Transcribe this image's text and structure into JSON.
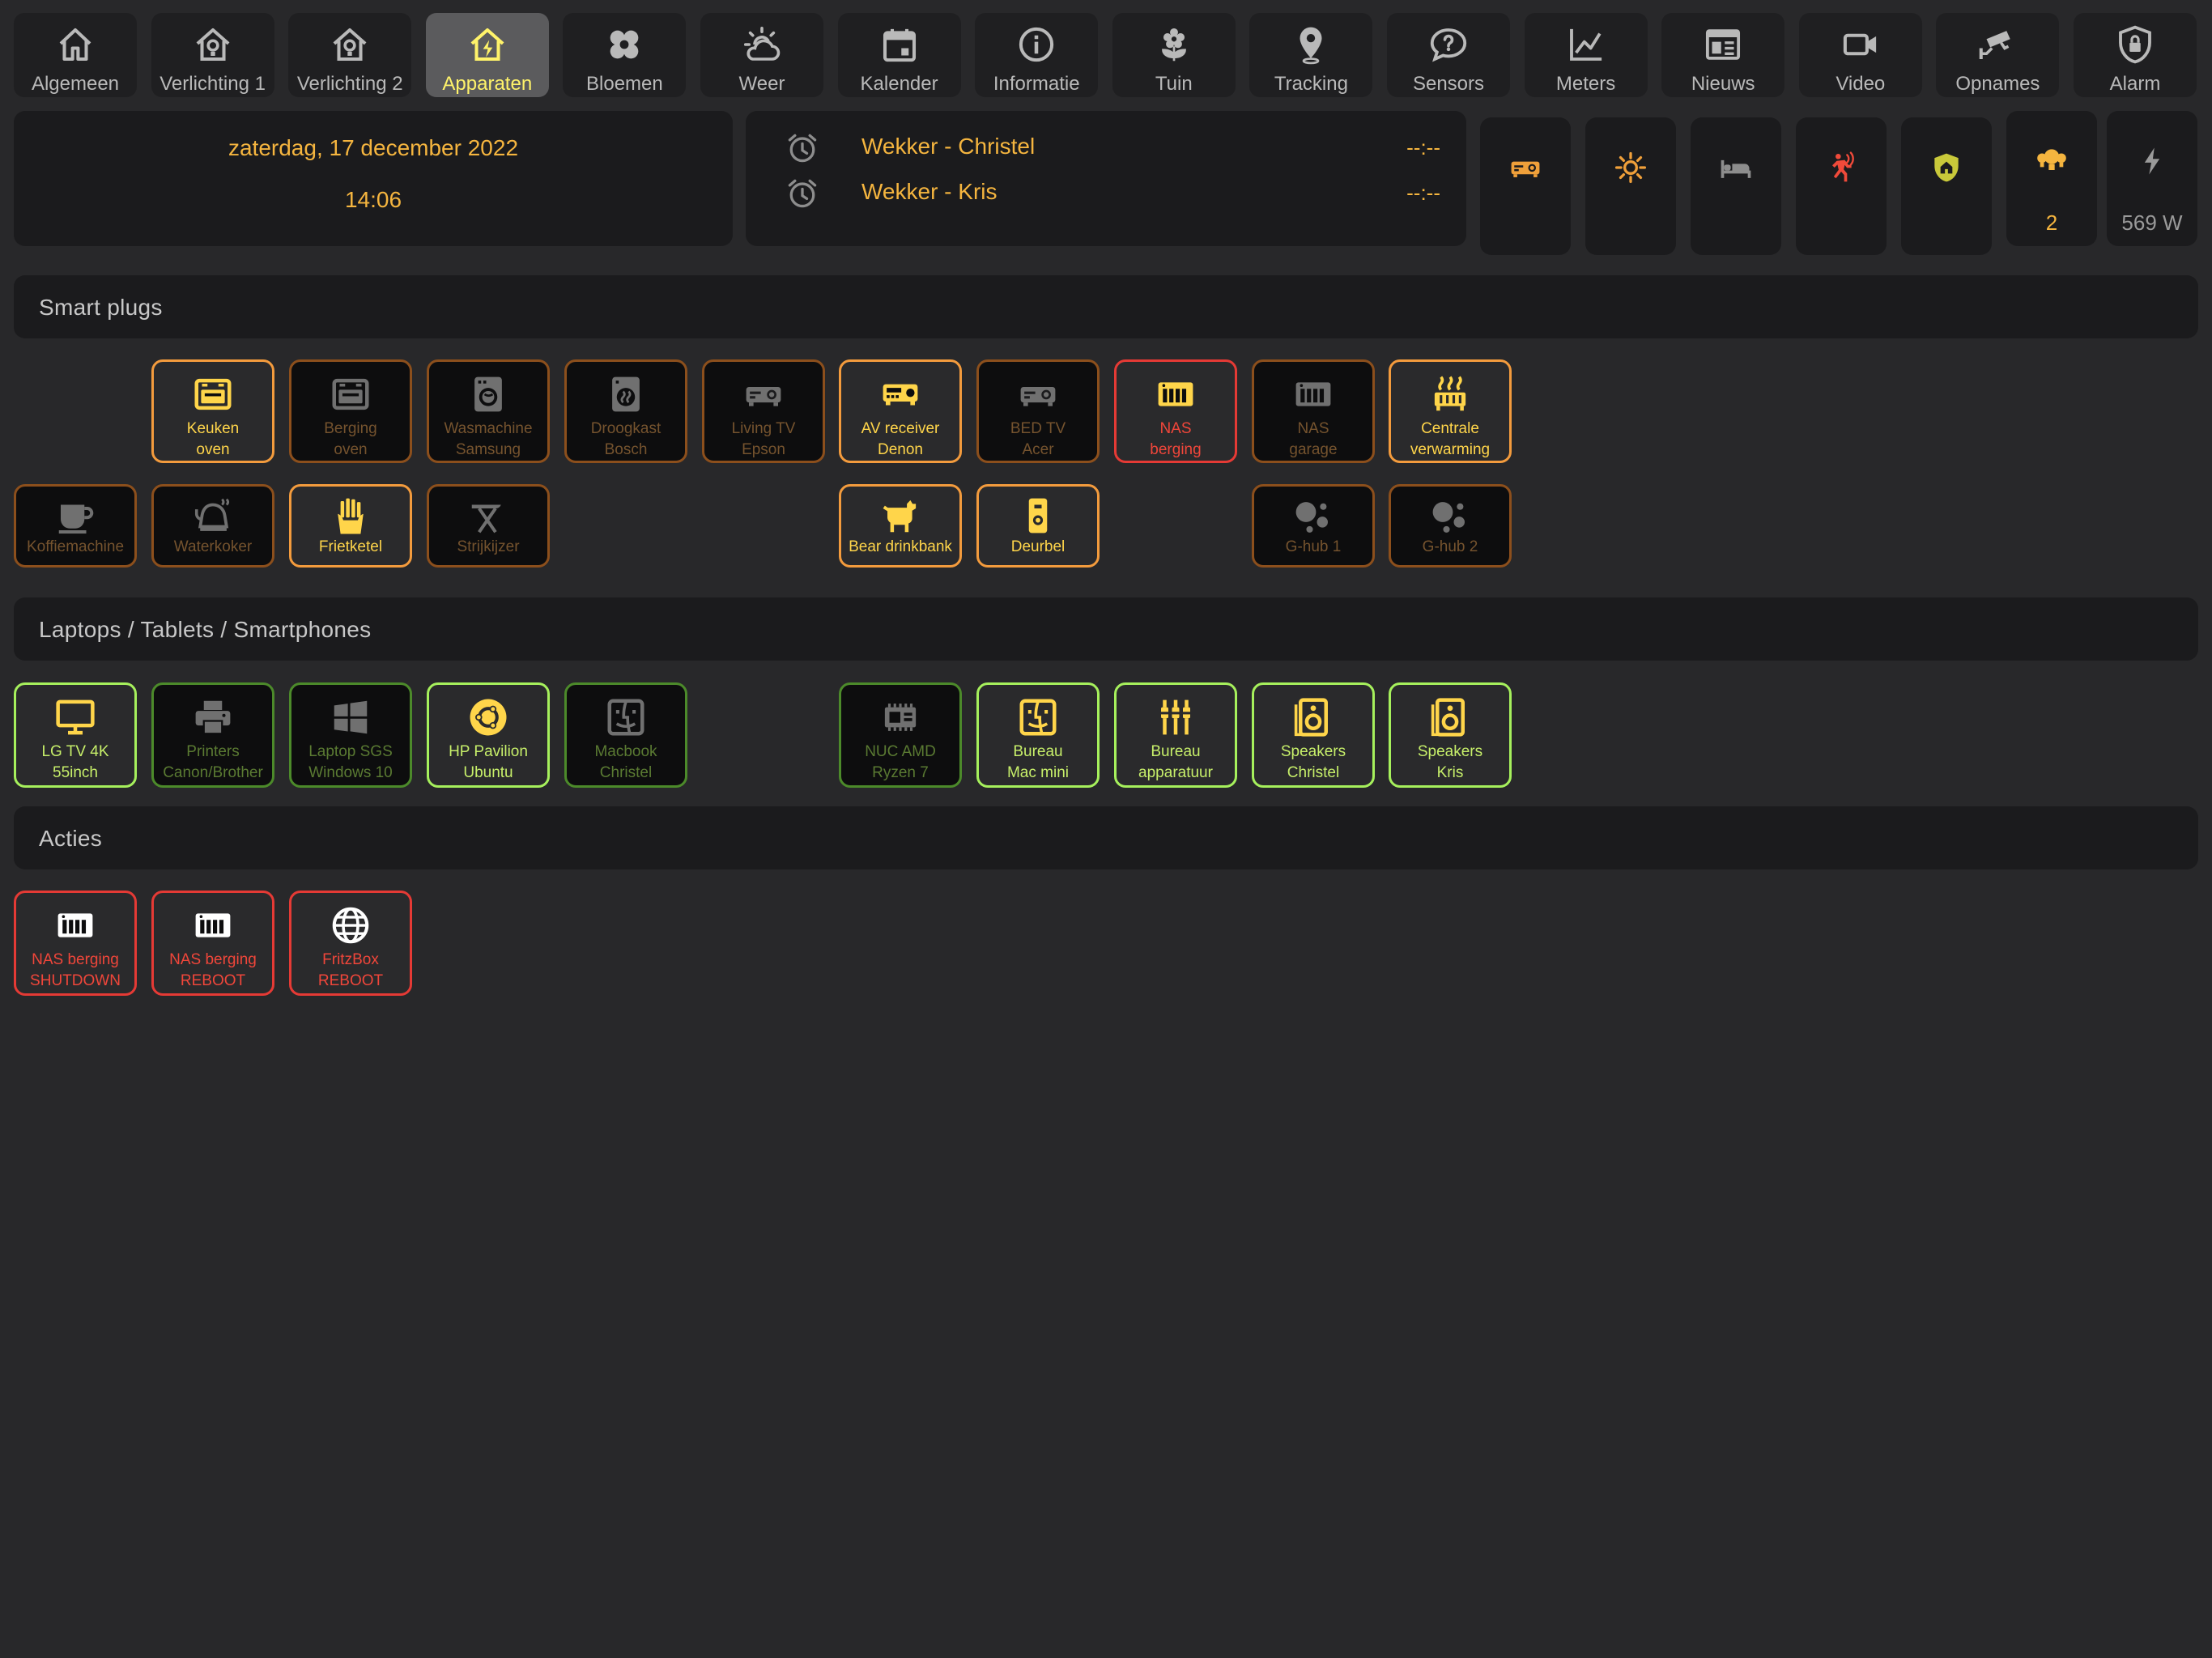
{
  "nav": [
    {
      "label": "Algemeen",
      "icon": "home-icon",
      "active": false
    },
    {
      "label": "Verlichting 1",
      "icon": "home-bulb-icon",
      "active": false
    },
    {
      "label": "Verlichting 2",
      "icon": "home-bulb-icon",
      "active": false
    },
    {
      "label": "Apparaten",
      "icon": "home-lightning-icon",
      "active": true
    },
    {
      "label": "Bloemen",
      "icon": "flower-icon",
      "active": false
    },
    {
      "label": "Weer",
      "icon": "weather-partly-cloudy-icon",
      "active": false
    },
    {
      "label": "Kalender",
      "icon": "calendar-icon",
      "active": false
    },
    {
      "label": "Informatie",
      "icon": "info-icon",
      "active": false
    },
    {
      "label": "Tuin",
      "icon": "flower-sprout-icon",
      "active": false
    },
    {
      "label": "Tracking",
      "icon": "map-marker-icon",
      "active": false
    },
    {
      "label": "Sensors",
      "icon": "chat-question-icon",
      "active": false
    },
    {
      "label": "Meters",
      "icon": "chart-line-icon",
      "active": false
    },
    {
      "label": "Nieuws",
      "icon": "newspaper-icon",
      "active": false
    },
    {
      "label": "Video",
      "icon": "video-camera-icon",
      "active": false
    },
    {
      "label": "Opnames",
      "icon": "cctv-icon",
      "active": false
    },
    {
      "label": "Alarm",
      "icon": "shield-lock-icon",
      "active": false
    }
  ],
  "header": {
    "date": "zaterdag, 17 december 2022",
    "time": "14:06",
    "alarms": [
      {
        "name": "Wekker - Christel",
        "value": "--:--",
        "icon": "alarm-clock-icon"
      },
      {
        "name": "Wekker - Kris",
        "value": "--:--",
        "icon": "alarm-clock-icon"
      }
    ],
    "status_tiles": [
      {
        "icon": "projector-icon",
        "value": "",
        "color": "#f0a03a"
      },
      {
        "icon": "brightness-icon",
        "value": "",
        "color": "#f0a03a"
      },
      {
        "icon": "bed-icon",
        "value": "",
        "color": "#8d8d8d"
      },
      {
        "icon": "motion-sensor-icon",
        "value": "",
        "color": "#f04a3a"
      },
      {
        "icon": "shield-home-icon",
        "value": "",
        "color": "#c9c93a"
      },
      {
        "icon": "lightbulb-group-icon",
        "value": "2",
        "color": "#f5b53f"
      },
      {
        "icon": "lightning-bolt-icon",
        "value": "569 W",
        "color": "#9a9a9a"
      }
    ]
  },
  "sections": {
    "smart_plugs": "Smart plugs",
    "laptops": "Laptops / Tablets / Smartphones",
    "actions": "Acties"
  },
  "smart_plugs_row1": [
    {
      "l1": "Keuken",
      "l2": "oven",
      "icon": "oven-icon",
      "state": "orange-on",
      "color": "#ffd54a"
    },
    {
      "l1": "Berging",
      "l2": "oven",
      "icon": "oven-icon",
      "state": "orange-off",
      "color": "#707070"
    },
    {
      "l1": "Wasmachine",
      "l2": "Samsung",
      "icon": "washing-machine-icon",
      "state": "orange-off",
      "color": "#707070"
    },
    {
      "l1": "Droogkast",
      "l2": "Bosch",
      "icon": "tumble-dryer-icon",
      "state": "orange-off",
      "color": "#707070"
    },
    {
      "l1": "Living TV",
      "l2": "Epson",
      "icon": "projector-icon",
      "state": "orange-off",
      "color": "#707070"
    },
    {
      "l1": "AV receiver",
      "l2": "Denon",
      "icon": "audio-receiver-icon",
      "state": "orange-on",
      "color": "#ffd54a"
    },
    {
      "l1": "BED TV",
      "l2": "Acer",
      "icon": "projector-icon",
      "state": "orange-off",
      "color": "#707070"
    },
    {
      "l1": "NAS",
      "l2": "berging",
      "icon": "nas-icon",
      "state": "red-on",
      "color": "#ffd54a"
    },
    {
      "l1": "NAS",
      "l2": "garage",
      "icon": "nas-icon",
      "state": "orange-off",
      "color": "#707070"
    },
    {
      "l1": "Centrale",
      "l2": "verwarming",
      "icon": "radiator-icon",
      "state": "orange-on",
      "color": "#ffd54a"
    }
  ],
  "smart_plugs_row2": [
    {
      "l1": "Koffiemachine",
      "icon": "coffee-icon",
      "state": "orange-off",
      "color": "#707070"
    },
    {
      "l1": "Waterkoker",
      "icon": "kettle-icon",
      "state": "orange-off",
      "color": "#707070"
    },
    {
      "l1": "Frietketel",
      "icon": "french-fries-icon",
      "state": "orange-on",
      "color": "#ffd54a"
    },
    {
      "l1": "Strijkijzer",
      "icon": "ironing-board-icon",
      "state": "orange-off",
      "color": "#707070"
    },
    {
      "l1": "Bear drinkbank",
      "icon": "dog-icon",
      "state": "orange-on",
      "color": "#ffd54a"
    },
    {
      "l1": "Deurbel",
      "icon": "doorbell-icon",
      "state": "orange-on",
      "color": "#ffd54a"
    },
    {
      "l1": "G-hub 1",
      "icon": "google-assistant-icon",
      "state": "orange-off",
      "color": "#707070"
    },
    {
      "l1": "G-hub 2",
      "icon": "google-assistant-icon",
      "state": "orange-off",
      "color": "#707070"
    }
  ],
  "laptops": [
    {
      "l1": "LG TV 4K",
      "l2": "55inch",
      "icon": "monitor-icon",
      "state": "green-on",
      "color": "#ffd54a"
    },
    {
      "l1": "Printers",
      "l2": "Canon/Brother",
      "icon": "printer-icon",
      "state": "green-off",
      "color": "#707070"
    },
    {
      "l1": "Laptop SGS",
      "l2": "Windows 10",
      "icon": "windows-icon",
      "state": "green-off",
      "color": "#707070"
    },
    {
      "l1": "HP Pavilion",
      "l2": "Ubuntu",
      "icon": "ubuntu-icon",
      "state": "green-on",
      "color": "#ffd54a"
    },
    {
      "l1": "Macbook",
      "l2": "Christel",
      "icon": "finder-icon",
      "state": "green-off",
      "color": "#707070"
    },
    {
      "l1": "NUC AMD",
      "l2": "Ryzen 7",
      "icon": "chip-icon",
      "state": "green-off",
      "color": "#707070"
    },
    {
      "l1": "Bureau",
      "l2": "Mac mini",
      "icon": "finder-icon",
      "state": "green-on",
      "color": "#ffd54a"
    },
    {
      "l1": "Bureau",
      "l2": "apparatuur",
      "icon": "audio-input-rca-icon",
      "state": "green-on",
      "color": "#ffd54a"
    },
    {
      "l1": "Speakers",
      "l2": "Christel",
      "icon": "speaker-icon",
      "state": "green-on",
      "color": "#ffd54a"
    },
    {
      "l1": "Speakers",
      "l2": "Kris",
      "icon": "speaker-icon",
      "state": "green-on",
      "color": "#ffd54a"
    }
  ],
  "actions": [
    {
      "l1": "NAS berging",
      "l2": "SHUTDOWN",
      "icon": "nas-icon",
      "state": "action",
      "color": "#ffffff"
    },
    {
      "l1": "NAS berging",
      "l2": "REBOOT",
      "icon": "nas-icon",
      "state": "action",
      "color": "#ffffff"
    },
    {
      "l1": "FritzBox",
      "l2": "REBOOT",
      "icon": "web-icon",
      "state": "action",
      "color": "#ffffff"
    }
  ]
}
